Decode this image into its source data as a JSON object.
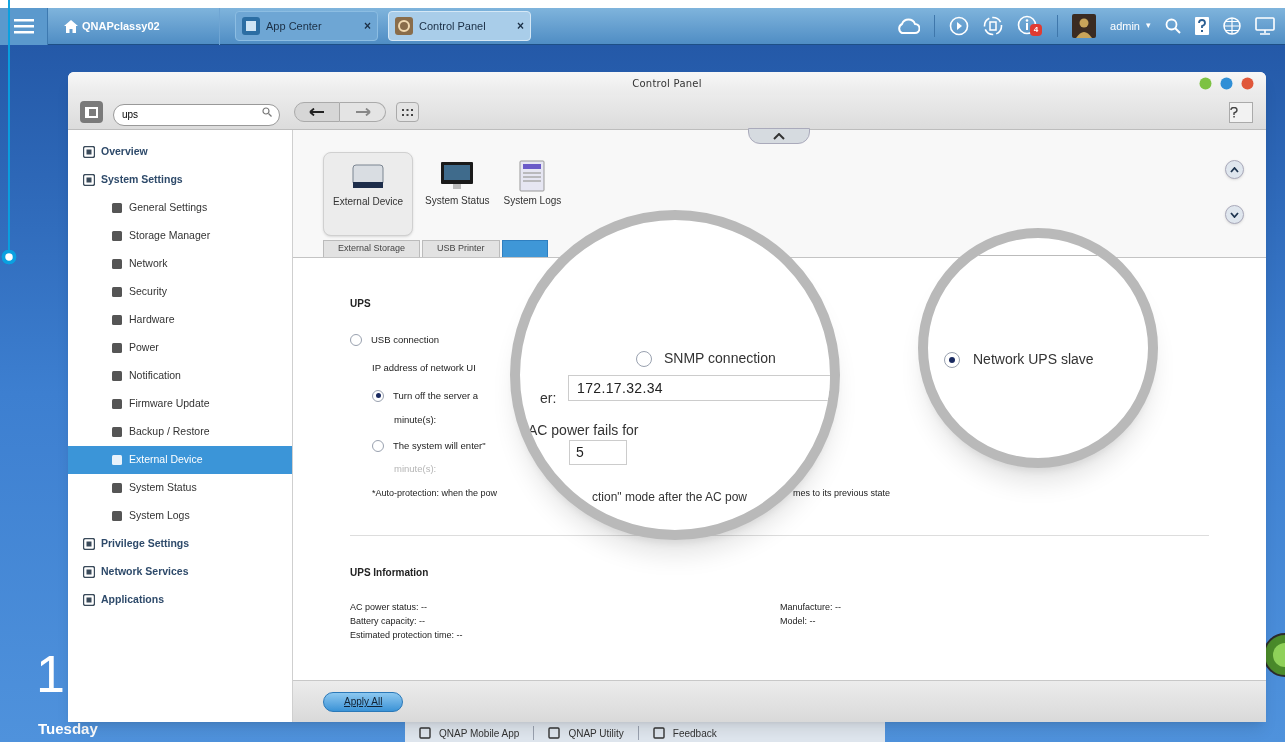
{
  "taskbar": {
    "host": "QNAPclassy02",
    "tabs": [
      {
        "label": "App Center",
        "selected": false,
        "close": "×"
      },
      {
        "label": "Control Panel",
        "selected": true,
        "close": "×"
      }
    ],
    "badge": "4",
    "user": "admin",
    "user_caret": "▾"
  },
  "window": {
    "title": "Control Panel",
    "search": {
      "value": "ups"
    }
  },
  "sidebar": {
    "items": [
      {
        "label": "Overview",
        "selected": false
      },
      {
        "label": "System Settings",
        "selected": false,
        "children": [
          {
            "label": "General Settings",
            "selected": false
          },
          {
            "label": "Storage Manager",
            "selected": false
          },
          {
            "label": "Network",
            "selected": false
          },
          {
            "label": "Security",
            "selected": false
          },
          {
            "label": "Hardware",
            "selected": false
          },
          {
            "label": "Power",
            "selected": false
          },
          {
            "label": "Notification",
            "selected": false
          },
          {
            "label": "Firmware Update",
            "selected": false
          },
          {
            "label": "Backup / Restore",
            "selected": false
          },
          {
            "label": "External Device",
            "selected": true
          },
          {
            "label": "System Status",
            "selected": false
          },
          {
            "label": "System Logs",
            "selected": false
          }
        ]
      },
      {
        "label": "Privilege Settings",
        "selected": false
      },
      {
        "label": "Network Services",
        "selected": false
      },
      {
        "label": "Applications",
        "selected": false
      }
    ]
  },
  "top_icons": [
    {
      "label": "External Device",
      "selected": true
    },
    {
      "label": "System Status",
      "selected": false
    },
    {
      "label": "System Logs",
      "selected": false
    }
  ],
  "subtabs": [
    {
      "label": "External Storage",
      "selected": false
    },
    {
      "label": "USB Printer",
      "selected": false
    },
    {
      "selected": true
    }
  ],
  "ups": {
    "title": "UPS",
    "usb": {
      "label": "USB connection",
      "selected": false
    },
    "ip_label": "IP address of network UI",
    "turn_off": {
      "label": "Turn off the server a",
      "selected": true
    },
    "turn_off_unit": "minute(s):",
    "standby": {
      "label": "The system will enter\"",
      "selected": false
    },
    "standby_unit": {
      "label": "minute(s):",
      "disabled": true
    },
    "note_start": "*Auto-protection: when the pow",
    "note_end": "mes to its previous state"
  },
  "magnifier_1": {
    "snmp": {
      "label": "SNMP connection",
      "selected": false
    },
    "ip_label": "er:",
    "ip_value": "172.17.32.34",
    "fail_label": "AC power fails for",
    "minutes_value": "5",
    "note": "ction\" mode after the AC pow"
  },
  "magnifier_2": {
    "slave": {
      "label": "Network UPS slave",
      "selected": true
    }
  },
  "ups_info": {
    "title": "UPS Information",
    "left": [
      "AC power status: --",
      "Battery capacity: --",
      "Estimated protection time: --"
    ],
    "right": [
      "Manufacture: --",
      "Model: --"
    ]
  },
  "footer": {
    "apply": "Apply All"
  },
  "desktop": {
    "clock": "1",
    "date": "Tuesday",
    "dock": [
      "QNAP Mobile App",
      "QNAP Utility",
      "Feedback"
    ]
  }
}
